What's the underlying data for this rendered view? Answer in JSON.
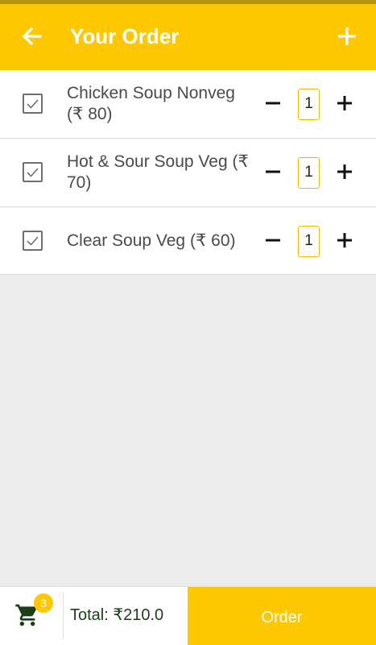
{
  "header": {
    "title": "Your Order",
    "back_icon": "arrow-left-icon",
    "add_icon": "plus-icon",
    "background_color": "#fec800"
  },
  "items": [
    {
      "name": "Chicken Soup Nonveg",
      "price": "(₹ 80)",
      "checked": true,
      "quantity": "1"
    },
    {
      "name": "Hot & Sour Soup Veg",
      "price": "(₹ 70)",
      "checked": true,
      "quantity": "1"
    },
    {
      "name": "Clear Soup Veg",
      "price": "(₹ 60)",
      "checked": true,
      "quantity": "1"
    }
  ],
  "footer": {
    "cart_icon": "cart-icon",
    "cart_count": "3",
    "total": "Total: ₹210.0",
    "order_label": "Order",
    "accent_color": "#fec800"
  }
}
